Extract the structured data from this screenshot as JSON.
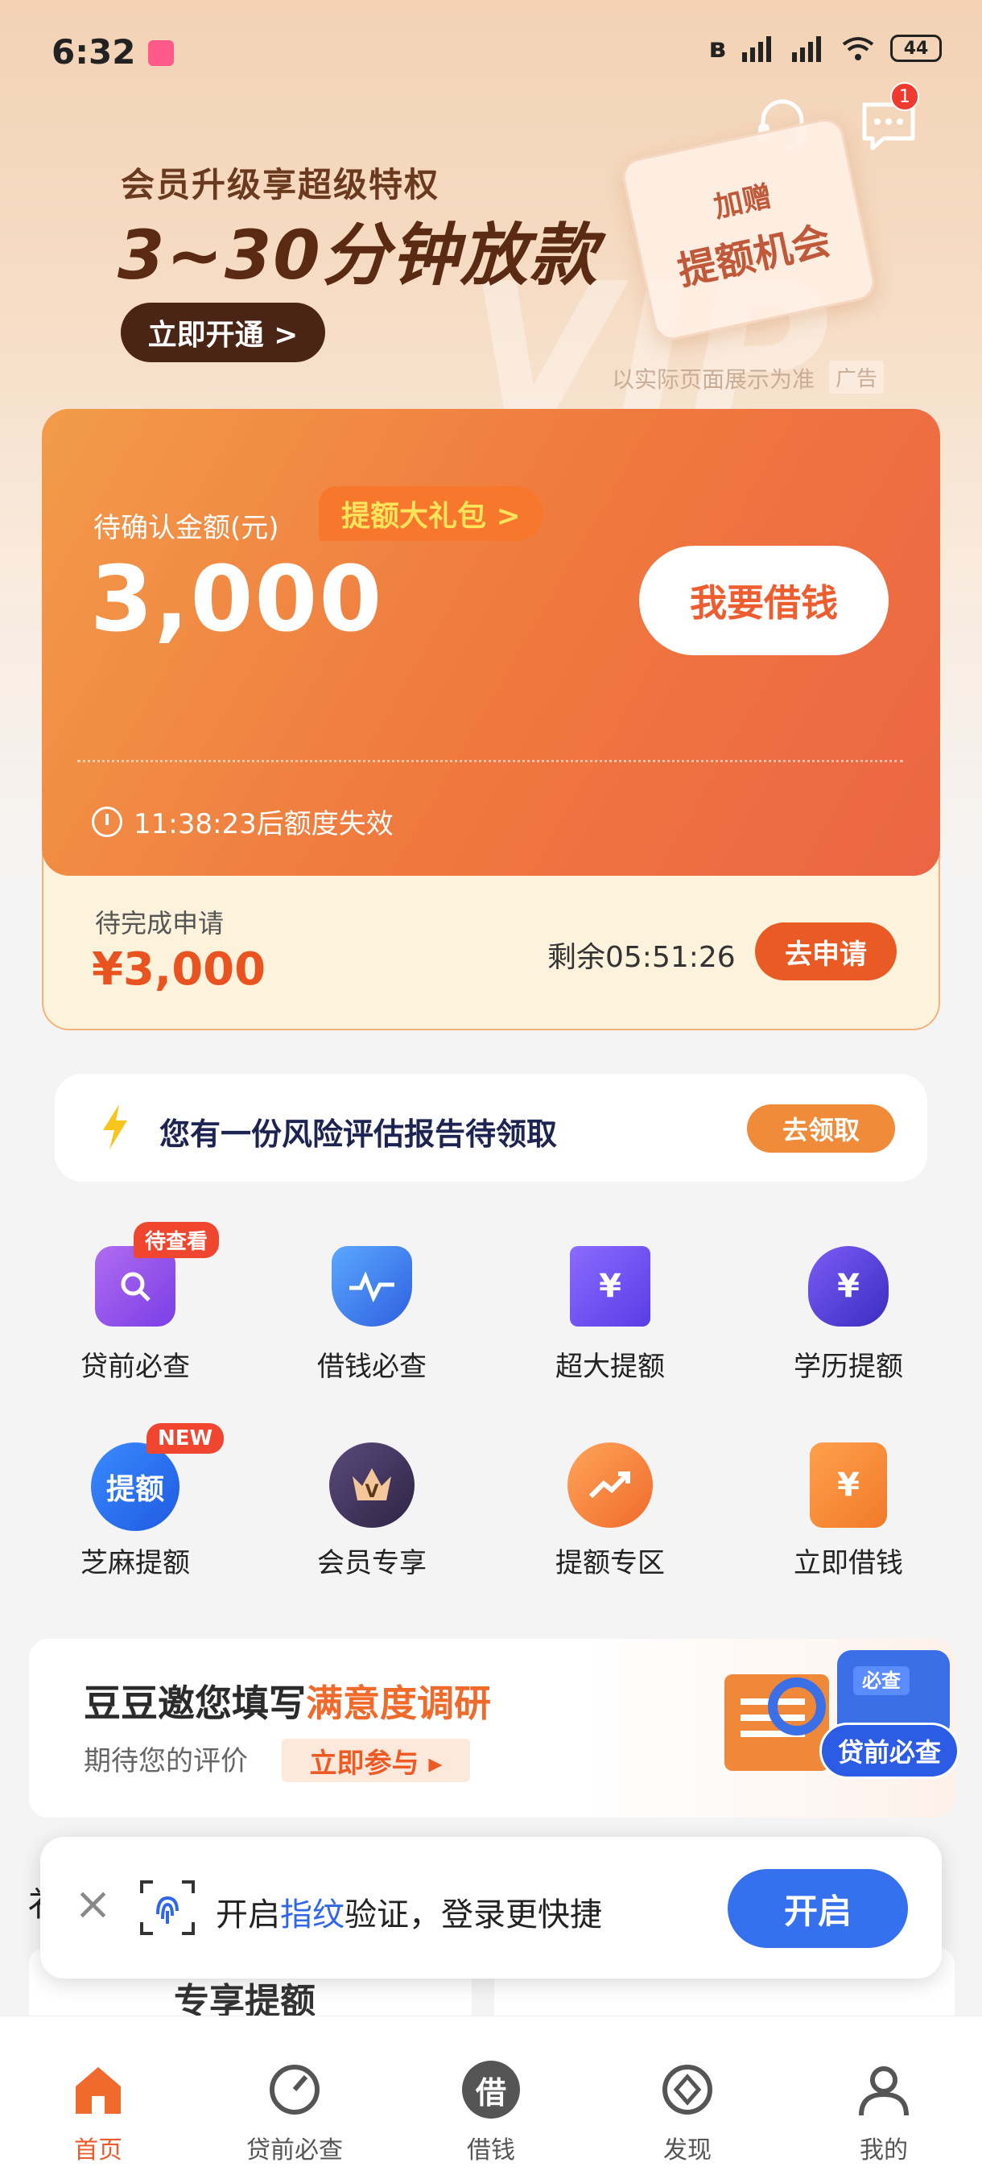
{
  "status_bar": {
    "time": "6:32",
    "battery": "44"
  },
  "header": {
    "message_badge": "1"
  },
  "banner": {
    "subtitle": "会员升级享超级特权",
    "title": "3~30分钟放款",
    "button": "立即开通 >",
    "card_line1": "加赠",
    "card_line2": "提额机会",
    "note": "以实际页面展示为准",
    "ad_tag": "广告"
  },
  "loan": {
    "label": "待确认金额(元)",
    "gift_tag": "提额大礼包 >",
    "amount": "3,000",
    "borrow_button": "我要借钱",
    "expire_text": "11:38:23后额度失效"
  },
  "pending": {
    "label": "待完成申请",
    "amount": "¥3,000",
    "remain": "剩余05:51:26",
    "button": "去申请"
  },
  "risk": {
    "text": "您有一份风险评估报告待领取",
    "button": "去领取"
  },
  "grid": [
    {
      "label": "贷前必查",
      "tag": "待查看"
    },
    {
      "label": "借钱必查"
    },
    {
      "label": "超大提额"
    },
    {
      "label": "学历提额"
    },
    {
      "label": "芝麻提额",
      "tag": "NEW",
      "icon_text": "提额"
    },
    {
      "label": "会员专享"
    },
    {
      "label": "提额专区"
    },
    {
      "label": "立即借钱"
    }
  ],
  "survey": {
    "title_prefix": "豆豆邀您填写",
    "title_highlight": "满意度调研",
    "subtitle": "期待您的评价",
    "button": "立即参与 ▸",
    "art_tag": "贷前必查",
    "art_small": "必查"
  },
  "behind": {
    "title": "专享提额"
  },
  "toast": {
    "text_prefix": "开启",
    "text_highlight": "指纹",
    "text_suffix": "验证，登录更快捷",
    "button": "开启"
  },
  "tabs": [
    {
      "label": "首页",
      "active": true
    },
    {
      "label": "贷前必查"
    },
    {
      "label": "借钱",
      "icon_text": "借"
    },
    {
      "label": "发现"
    },
    {
      "label": "我的"
    }
  ],
  "colors": {
    "accent": "#ee5b2a",
    "primary_blue": "#3570ee",
    "card_gradient_start": "#f29b4a",
    "card_gradient_end": "#ec6444"
  }
}
